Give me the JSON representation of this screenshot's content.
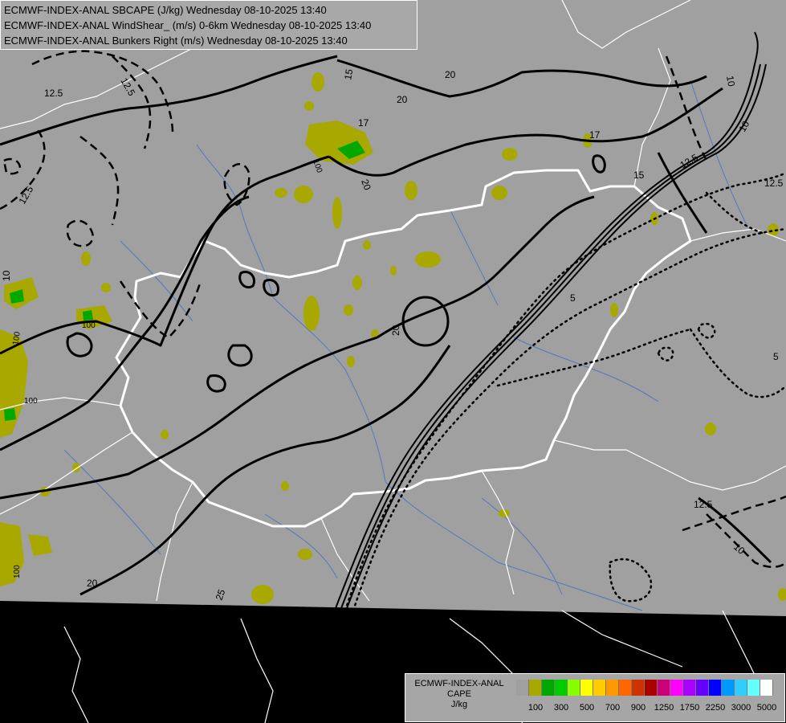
{
  "titles": [
    "ECMWF-INDEX-ANAL SBCAPE (J/kg) Wednesday 08-10-2025 13:40",
    "ECMWF-INDEX-ANAL WindShear_ (m/s) 0-6km Wednesday 08-10-2025 13:40",
    "ECMWF-INDEX-ANAL Bunkers Right (m/s) Wednesday 08-10-2025 13:40"
  ],
  "legend": {
    "model": "ECMWF-INDEX-ANAL",
    "variable": "CAPE",
    "unit": "J/kg",
    "colors": [
      "#a0a0a0",
      "#a8a800",
      "#00a800",
      "#00cc00",
      "#88ff00",
      "#ffff00",
      "#ffcc00",
      "#ff9900",
      "#ff6600",
      "#cc3300",
      "#aa0000",
      "#cc0077",
      "#ff00ff",
      "#aa00ff",
      "#6600ff",
      "#0000ff",
      "#0099ff",
      "#33ccff",
      "#66ffff",
      "#ffffff"
    ],
    "tick_labels": [
      "100",
      "300",
      "500",
      "700",
      "900",
      "1250",
      "1750",
      "2250",
      "3000",
      "5000"
    ]
  },
  "contour_labels": {
    "shear": [
      "12.5",
      "12.5",
      "12.5",
      "15",
      "20",
      "17",
      "20",
      "20",
      "17",
      "15",
      "12.5",
      "10",
      "10",
      "20",
      "25",
      "20",
      "10",
      "12.5",
      "10",
      "12.5"
    ],
    "bunkers": [
      "5",
      "5"
    ],
    "cape": [
      "100",
      "100",
      "100",
      "100",
      "100"
    ]
  },
  "colors": {
    "map_background": "#a0a0a0",
    "outside_domain": "#000000",
    "borders": "#ffffff",
    "rivers": "#5577bb",
    "contours": "#000000",
    "cape_low": "#a8a800",
    "cape_mid": "#00a800"
  }
}
